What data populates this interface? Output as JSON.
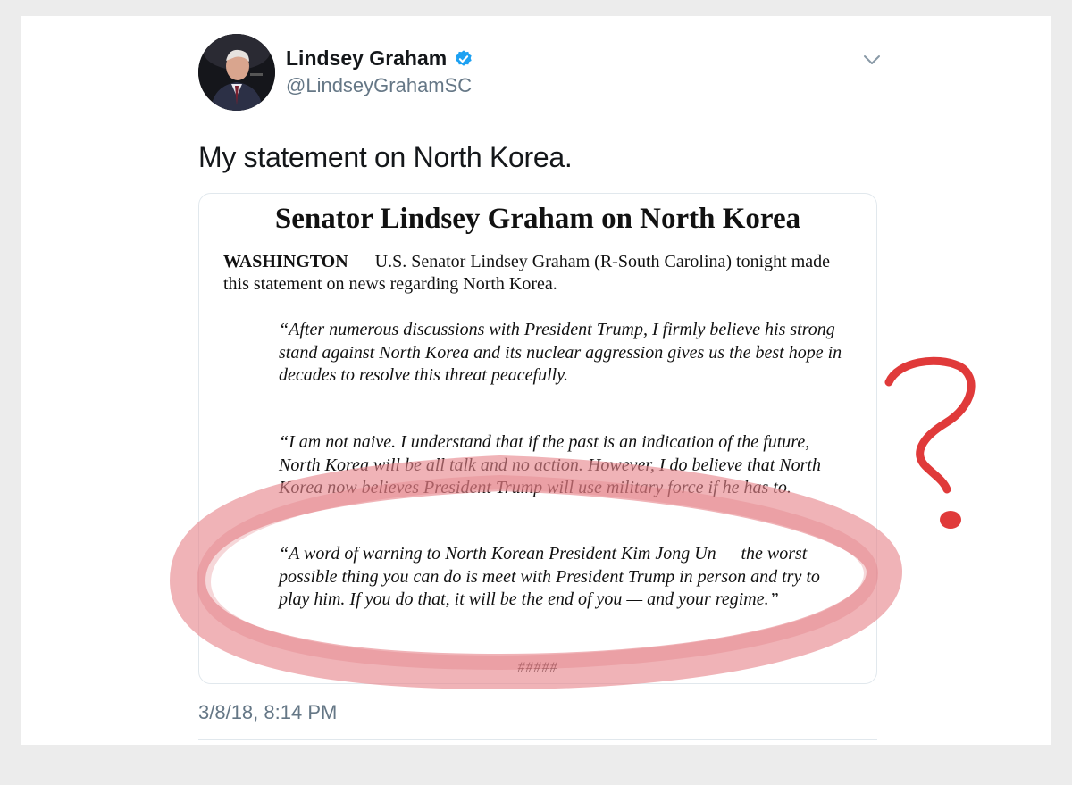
{
  "tweet": {
    "author_name": "Lindsey Graham",
    "handle": "@LindseyGrahamSC",
    "text": "My statement on North Korea.",
    "timestamp": "3/8/18, 8:14 PM",
    "verified": true
  },
  "document": {
    "title": "Senator Lindsey Graham on North Korea",
    "intro_lead": "WASHINGTON",
    "intro_body": " — U.S. Senator Lindsey Graham (R-South Carolina) tonight made this statement on news regarding North Korea.",
    "quote1": "“After numerous discussions with President Trump, I firmly believe his strong stand against North Korea and its nuclear aggression gives us the best hope in decades to resolve this threat peacefully.",
    "quote2": "“I am not naive.  I understand that if the past is an indication of the future, North Korea will be all talk and no action.  However, I do believe that North Korea now believes President Trump will use military force if he has to.",
    "quote3": "“A word of warning to North Korean President Kim Jong Un — the worst possible thing you can do is meet with President Trump in person and try to play him.  If you do that, it will be the end of you — and your regime.”",
    "end_mark": "#####"
  },
  "icons": {
    "verified": "verified-badge-icon",
    "menu": "chevron-down-icon"
  },
  "colors": {
    "verified": "#1da1f2",
    "annotation": "#e03a3a",
    "highlight": "#e8898b",
    "muted_text": "#657786"
  }
}
